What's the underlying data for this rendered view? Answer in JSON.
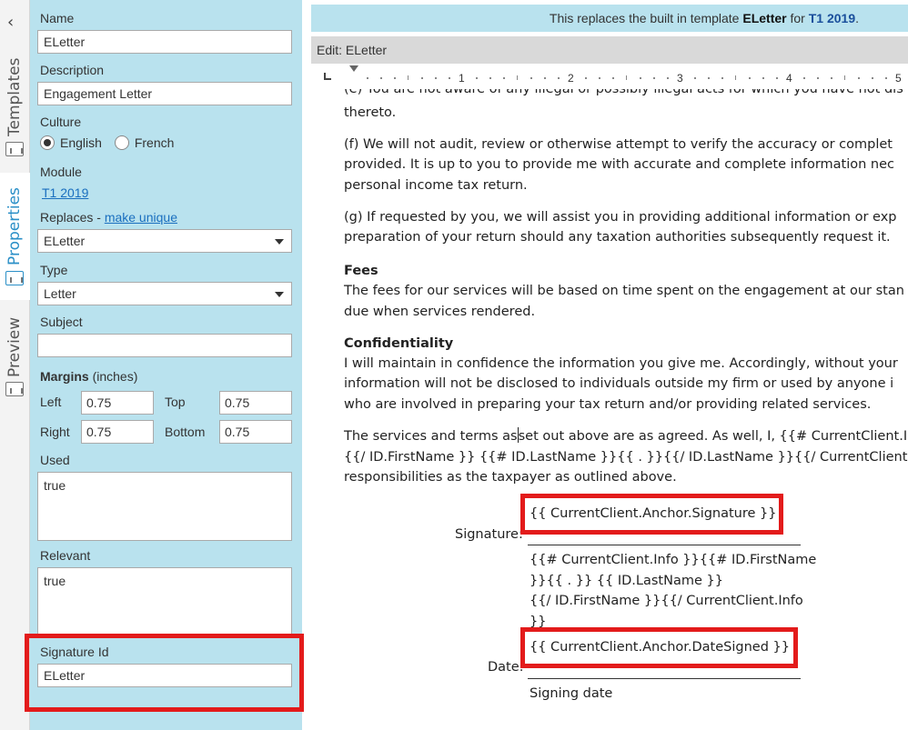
{
  "tabs": [
    {
      "label": "Templates"
    },
    {
      "label": "Properties"
    },
    {
      "label": "Preview"
    }
  ],
  "properties": {
    "name_label": "Name",
    "name_value": "ELetter",
    "description_label": "Description",
    "description_value": "Engagement Letter",
    "culture_label": "Culture",
    "culture_english": "English",
    "culture_french": "French",
    "module_label": "Module",
    "module_link": "T1 2019",
    "replaces_label": "Replaces - ",
    "make_unique": "make unique",
    "replaces_value": "ELetter",
    "type_label": "Type",
    "type_value": "Letter",
    "subject_label": "Subject",
    "subject_value": "",
    "margins_label": "Margins",
    "margins_unit": " (inches)",
    "left_label": "Left",
    "left_value": "0.75",
    "top_label": "Top",
    "top_value": "0.75",
    "right_label": "Right",
    "right_value": "0.75",
    "bottom_label": "Bottom",
    "bottom_value": "0.75",
    "used_label": "Used",
    "used_value": "true",
    "relevant_label": "Relevant",
    "relevant_value": "true",
    "signature_id_label": "Signature Id",
    "signature_id_value": "ELetter"
  },
  "banner": {
    "prefix": "This replaces the built in template ",
    "template": "ELetter",
    "mid": " for ",
    "module": "T1 2019",
    "suffix": "."
  },
  "editbar": {
    "label": "Edit: ELetter"
  },
  "ruler": {
    "numbers": [
      "1",
      "2",
      "3",
      "4",
      "5"
    ]
  },
  "doc": {
    "line_top_partial": "(e) You are not aware of any illegal or possibly illegal acts for which you have not dis",
    "line1": "thereto.",
    "f1": "(f) We will not audit, review or otherwise attempt to verify the accuracy or complet",
    "f2": "provided. It is up to you to provide me with accurate and complete information nec",
    "f3": "personal income tax return.",
    "g1": "(g) If requested by you, we will assist you in providing additional information or exp",
    "g2": "preparation of your return should any taxation authorities subsequently request it.",
    "fees_title": "Fees",
    "fees1": "The fees for our services will be based on time spent on the engagement at our stan",
    "fees2": "due when services rendered.",
    "conf_title": "Confidentiality",
    "conf1": "I will maintain in confidence the information you give me. Accordingly, without your",
    "conf2": "information will not be disclosed to individuals outside my firm or used by anyone i",
    "conf3": "who are involved in preparing your tax return and/or providing related services.",
    "terms1a": "The services and terms as",
    "terms1b": "set out above are as agreed. As well, I, {{# CurrentClient.In",
    "terms2": "{{/ ID.FirstName }} {{# ID.LastName }}{{ . }}{{/ ID.LastName }}{{/ CurrentClient.Info }},",
    "terms3": "responsibilities as the taxpayer as outlined above.",
    "signature_label": "Signature:",
    "signature_field": "{{ CurrentClient.Anchor.Signature }}",
    "name1": "{{# CurrentClient.Info }}{{# ID.FirstName",
    "name2": "}}{{ . }} {{ ID.LastName }}",
    "name3": "{{/ ID.FirstName }}{{/ CurrentClient.Info",
    "name4": "}}",
    "date_label": "Date:",
    "date_field": "{{ CurrentClient.Anchor.DateSigned }}",
    "signing_date": "Signing date"
  }
}
